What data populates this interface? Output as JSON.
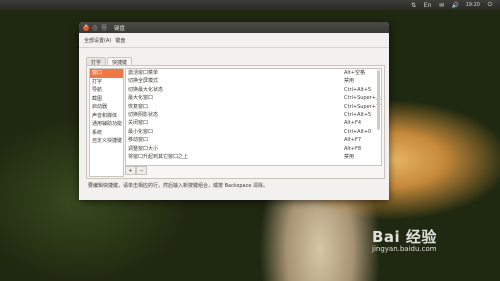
{
  "topbar": {
    "time": "19:20",
    "indicators": [
      "⇅",
      "En",
      "✉",
      "🔊"
    ]
  },
  "window": {
    "title": "键盘",
    "toolbar": {
      "all_settings": "全部设置(A)",
      "current": "键盘"
    },
    "tabs": [
      "打字",
      "快捷键"
    ],
    "categories": [
      "窗口",
      "打字",
      "导航",
      "截图",
      "启动器",
      "声音和媒体",
      "通用辅助功能",
      "系统",
      "自定义快捷键"
    ],
    "shortcuts": [
      {
        "action": "激活窗口菜单",
        "key": "Alt+空格"
      },
      {
        "action": "切换全屏模式",
        "key": "禁用"
      },
      {
        "action": "切换最大化状态",
        "key": "Ctrl+Alt+5"
      },
      {
        "action": "最大化窗口",
        "key": "Ctrl+Super+上"
      },
      {
        "action": "恢复窗口",
        "key": "Ctrl+Super+下"
      },
      {
        "action": "切换阴影状态",
        "key": "Ctrl+Alt+5"
      },
      {
        "action": "关闭窗口",
        "key": "Alt+F4"
      },
      {
        "action": "最小化窗口",
        "key": "Ctrl+Alt+0"
      },
      {
        "action": "移动窗口",
        "key": "Alt+F7"
      },
      {
        "action": "调整窗口大小",
        "key": "Alt+F8"
      },
      {
        "action": "将窗口升起到其它窗口之上",
        "key": "禁用"
      }
    ],
    "add_button": "+",
    "remove_button": "−",
    "hint": "要编辑快捷键，请单击相应的行，然后输入新按键组合，或按 Backspace 清除。"
  },
  "watermark": {
    "brand": "Bai 经验",
    "url": "jingyan.baidu.com"
  }
}
